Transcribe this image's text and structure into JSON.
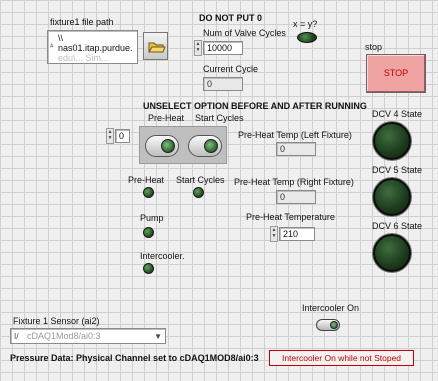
{
  "fixture_path": {
    "label": "fixture1 file path",
    "prefix_glyph": "ᴬ",
    "line1": "\\\\",
    "line2": "nas01.itap.purdue.",
    "line3": "edu\\... Sim..."
  },
  "warning_top": "DO NOT PUT 0",
  "valve_cycles": {
    "label": "Num of Valve Cycles",
    "value": "10000"
  },
  "xy_led_label": "x = y?",
  "current_cycle": {
    "label": "Current Cycle",
    "value": "0"
  },
  "stop": {
    "label": "stop",
    "button": "STOP"
  },
  "unselect_warning": "UNSELECT OPTION BEFORE AND AFTER RUNNING",
  "preheat_header": "Pre-Heat",
  "start_cycles_header": "Start Cycles",
  "left_numeric_value": "0",
  "preheat_led_label": "Pre-Heat",
  "start_cycles_led_label": "Start Cycles",
  "pump_label": "Pump",
  "intercooler_label": "Intercooler.",
  "preheat_temp_left": {
    "label": "Pre-Heat Temp (Left Fixture)",
    "value": "0"
  },
  "preheat_temp_right": {
    "label": "Pre-Heat Temp (Right Fixture)",
    "value": "0"
  },
  "preheat_temperature": {
    "label": "Pre-Heat Temperature",
    "value": "210"
  },
  "dcv4": "DCV 4 State",
  "dcv5": "DCV 5 State",
  "dcv6": "DCV 6 State",
  "intercooler_on_label": "Intercooler  On",
  "sensor": {
    "label": "Fixture 1 Sensor (ai2)",
    "prefix_glyph": "I/",
    "value": "cDAQ1Mod8/ai0:3"
  },
  "pressure_note": "Pressure Data: Physical Channel  set to cDAQ1MOD8/ai0:3",
  "intercooler_warning": "Intercooler On while not Stoped"
}
